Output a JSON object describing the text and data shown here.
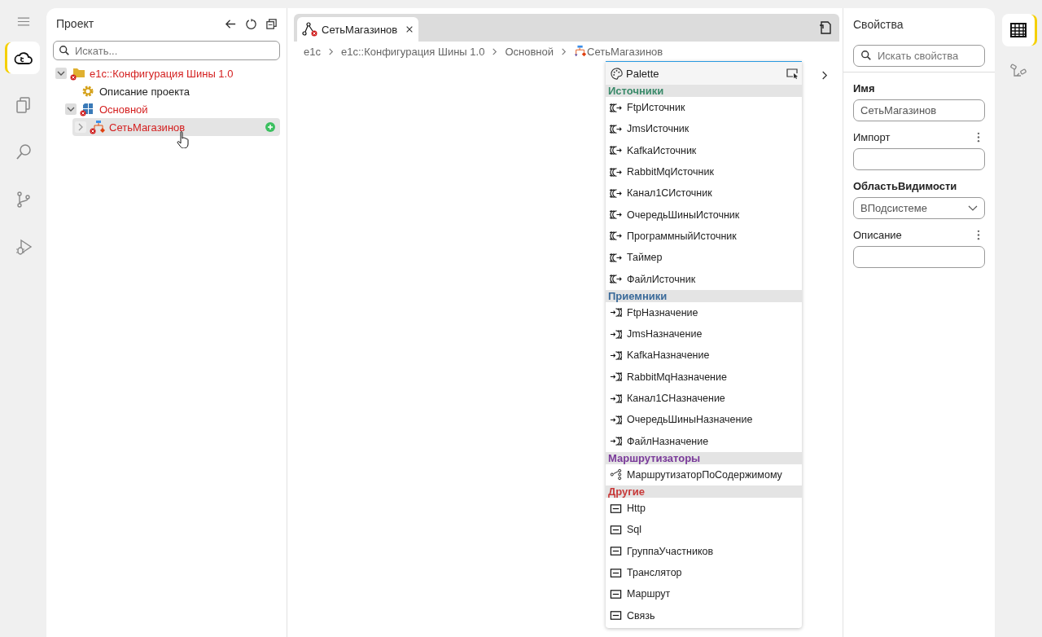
{
  "activity_bar": [
    {
      "selected": true
    },
    {
      "selected": false
    },
    {
      "selected": false
    },
    {
      "selected": false
    },
    {
      "selected": false
    }
  ],
  "project": {
    "title": "Проект",
    "search": {
      "placeholder": "Искать..."
    },
    "tree": [
      {
        "label": "e1c::Конфигурация Шины 1.0",
        "kind": "config",
        "error": true,
        "expanded": true,
        "selected": false,
        "children": [
          {
            "label": "Описание проекта",
            "kind": "settings",
            "error": false,
            "selected": false
          },
          {
            "label": "Основной",
            "kind": "subsystem",
            "error": true,
            "expanded": true,
            "selected": false,
            "children": [
              {
                "label": "СетьМагазинов",
                "kind": "process",
                "error": true,
                "expanded": false,
                "selected": true,
                "add": true
              }
            ]
          }
        ]
      }
    ]
  },
  "editor": {
    "tabs": [
      {
        "label": "СетьМагазинов",
        "selected": true
      }
    ],
    "breadcrumb": [
      {
        "label": "e1c"
      },
      {
        "label": "e1c::Конфигурация Шины 1.0"
      },
      {
        "label": "Основной"
      },
      {
        "label": "СетьМагазинов",
        "icon": true
      }
    ],
    "palette": {
      "title": "Palette",
      "groups": [
        {
          "title": "Источники",
          "color": "#3a8a6a",
          "items": [
            "FtpИсточник",
            "JmsИсточник",
            "KafkaИсточник",
            "RabbitMqИсточник",
            "Канал1СИсточник",
            "ОчередьШиныИсточник",
            "ПрограммныйИсточник",
            "Таймер",
            "ФайлИсточник"
          ]
        },
        {
          "title": "Приемники",
          "color": "#3a6a9a",
          "items": [
            "FtpНазначение",
            "JmsНазначение",
            "KafkaНазначение",
            "RabbitMqНазначение",
            "Канал1СНазначение",
            "ОчередьШиныНазначение",
            "ФайлНазначение"
          ]
        },
        {
          "title": "Маршрутизаторы",
          "color": "#7a3a9a",
          "items": [
            "МаршрутизаторПоСодержимому"
          ]
        },
        {
          "title": "Другие",
          "color": "#c83a3a",
          "items": [
            "Http",
            "Sql",
            "ГруппаУчастников",
            "Транслятор",
            "Маршрут",
            "Связь"
          ]
        }
      ]
    }
  },
  "properties": {
    "title": "Свойства",
    "search": {
      "placeholder": "Искать свойства"
    },
    "fields": [
      {
        "label": "Имя",
        "kind": "text",
        "required": true,
        "menu": false,
        "value": "СетьМагазинов"
      },
      {
        "label": "Импорт",
        "kind": "text",
        "required": false,
        "menu": true
      },
      {
        "label": "ОбластьВидимости",
        "kind": "select",
        "required": true,
        "menu": false,
        "value": "ВПодсистеме"
      },
      {
        "label": "Описание",
        "kind": "text",
        "required": false,
        "menu": true
      }
    ]
  },
  "right_bar": [
    {
      "selected": true
    },
    {
      "selected": false
    }
  ]
}
